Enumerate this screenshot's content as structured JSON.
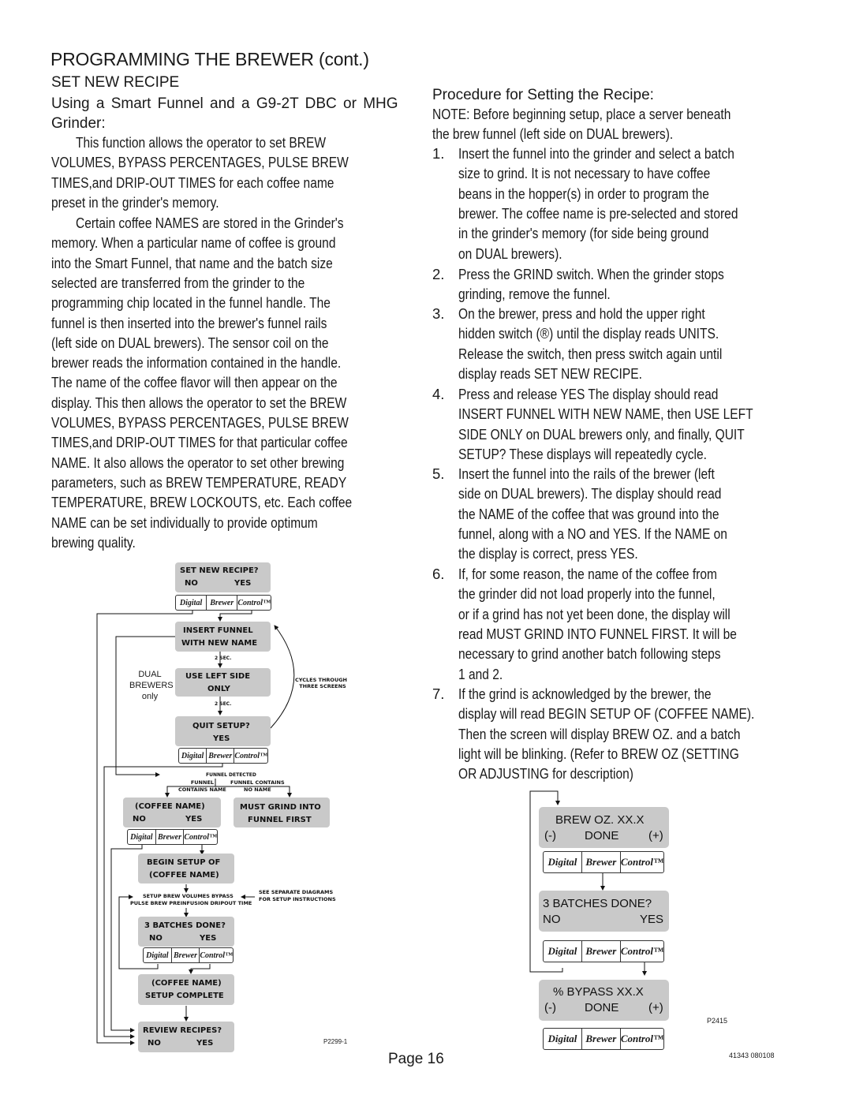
{
  "header": {
    "title": "PROGRAMMING THE BREWER (cont.)",
    "section": "SET NEW RECIPE",
    "subheading_line1": "Using a Smart Funnel and a G9-2T DBC or MHG",
    "subheading_line2": "Grinder:"
  },
  "left_text": {
    "p1": [
      "This function allows the operator to set BREW",
      "VOLUMES, BYPASS PERCENTAGES, PULSE BREW",
      "TIMES,and DRIP-OUT TIMES for each coffee name",
      "preset in the grinder's memory."
    ],
    "p2": [
      "Certain coffee NAMES are stored in the Grinder's",
      "memory. When a particular name of coffee is ground",
      "into the Smart Funnel, that name and the batch size",
      "selected are transferred from the grinder to the",
      "programming chip located in the funnel handle. The",
      "funnel is then inserted into the brewer's funnel rails",
      "(left side on DUAL brewers). The sensor coil on the",
      "brewer reads the information contained in the handle.",
      "The name of the coffee flavor will then appear on the",
      "display. This then allows the operator to set the BREW",
      "VOLUMES, BYPASS PERCENTAGES, PULSE BREW",
      "TIMES,and DRIP-OUT TIMES for that particular coffee",
      "NAME. It also allows the operator to set other brewing",
      "parameters, such as BREW TEMPERATURE, READY",
      "TEMPERATURE, BREW LOCKOUTS, etc. Each coffee",
      "NAME can be set individually to provide optimum",
      "brewing quality."
    ]
  },
  "right_text": {
    "heading": "Procedure for Setting the Recipe:",
    "note": [
      "NOTE: Before beginning setup, place a server beneath",
      "the brew funnel (left side on DUAL brewers)."
    ],
    "steps": [
      {
        "num": "1.",
        "lines": [
          "Insert the funnel into the grinder and select a batch",
          "size to grind. It is not necessary to have coffee",
          "beans in the hopper(s) in order to program the",
          "brewer. The coffee name is pre-selected and stored",
          "in the grinder's memory (for side being ground",
          "on DUAL brewers)."
        ]
      },
      {
        "num": "2.",
        "lines": [
          "Press the  GRIND switch. When the grinder stops",
          "grinding, remove the funnel."
        ]
      },
      {
        "num": "3.",
        "lines": [
          "On the brewer, press and hold the upper right",
          "hidden switch (®) until the display reads UNITS.",
          "Release the switch, then press switch again until",
          "display reads SET NEW RECIPE."
        ]
      },
      {
        "num": "4.",
        "lines": [
          "Press and release YES The display should read",
          "INSERT FUNNEL WITH NEW NAME, then USE LEFT",
          "SIDE ONLY on DUAL brewers only, and finally, QUIT",
          "SETUP? These displays will repeatedly cycle."
        ]
      },
      {
        "num": "5.",
        "lines": [
          "Insert  the funnel into the rails of the brewer (left",
          "side on DUAL brewers). The display should read",
          "the NAME of the coffee that was ground into the",
          "funnel, along with a NO and YES. If the NAME on",
          "the display is correct, press YES."
        ]
      },
      {
        "num": "6.",
        "lines": [
          "If, for some reason, the name of the coffee from",
          "the grinder did not load properly into the funnel,",
          "or if a grind has not yet been done, the display will",
          "read MUST GRIND INTO FUNNEL FIRST. It will be",
          "necessary to grind another batch following steps",
          "1 and 2."
        ]
      },
      {
        "num": "7.",
        "lines": [
          "If the grind is acknowledged by the brewer, the",
          "display will read BEGIN SETUP OF (COFFEE NAME).",
          "Then the screen will display BREW OZ. and a batch",
          "light will be blinking. (Refer to BREW OZ (SETTING",
          "OR ADJUSTING for description)"
        ]
      }
    ]
  },
  "logo": {
    "seg1": "Digital",
    "seg2": "Brewer",
    "seg3": "Control™"
  },
  "flowchart_left": {
    "set_new_recipe": {
      "line1": "SET NEW RECIPE?",
      "no": "NO",
      "yes": "YES"
    },
    "insert_funnel": {
      "line1": "INSERT FUNNEL",
      "line2": "WITH NEW NAME"
    },
    "delay1": "2 SEC.",
    "use_left_side": {
      "line1": "USE LEFT SIDE",
      "line2": "ONLY"
    },
    "delay2": "2 SEC.",
    "dual_label": [
      "DUAL",
      "BREWERS",
      "only"
    ],
    "cycles_label": [
      "CYCLES THROUGH",
      "THREE SCREENS"
    ],
    "quit_setup": {
      "line1": "QUIT SETUP?",
      "yes": "YES"
    },
    "funnel_detected": "FUNNEL DETECTED",
    "branch_left": [
      "FUNNEL",
      "CONTAINS NAME"
    ],
    "branch_right": [
      "FUNNEL CONTAINS",
      "NO NAME"
    ],
    "coffee_name": {
      "line1": "(COFFEE NAME)",
      "no": "NO",
      "yes": "YES"
    },
    "must_grind": {
      "line1": "MUST GRIND INTO",
      "line2": "FUNNEL FIRST"
    },
    "begin_setup": {
      "line1": "BEGIN SETUP OF",
      "line2": "(COFFEE NAME)"
    },
    "setup_steps": [
      "SETUP BREW VOLUMES BYPASS",
      "PULSE BREW PREINFUSION DRIPOUT TIME"
    ],
    "see_separate": [
      "SEE SEPARATE DIAGRAMS",
      "FOR SETUP INSTRUCTIONS"
    ],
    "batches_done": {
      "line1": "3 BATCHES DONE?",
      "no": "NO",
      "yes": "YES"
    },
    "setup_complete": {
      "line1": "(COFFEE NAME)",
      "line2": "SETUP COMPLETE"
    },
    "review_recipes": {
      "line1": "REVIEW RECIPES?",
      "no": "NO",
      "yes": "YES"
    },
    "figure_id": "P2299-1"
  },
  "flowchart_right": {
    "brew_oz": {
      "label": "BREW OZ.  XX.X",
      "minus": "(-)",
      "done": "DONE",
      "plus": "(+)"
    },
    "batches_done": {
      "line1": "3 BATCHES DONE?",
      "no": "NO",
      "yes": "YES"
    },
    "bypass": {
      "label": "% BYPASS  XX.X",
      "minus": "(-)",
      "done": "DONE",
      "plus": "(+)"
    },
    "figure_id": "P2415"
  },
  "footer": {
    "page": "Page 16",
    "doc_code": "41343 080108"
  }
}
